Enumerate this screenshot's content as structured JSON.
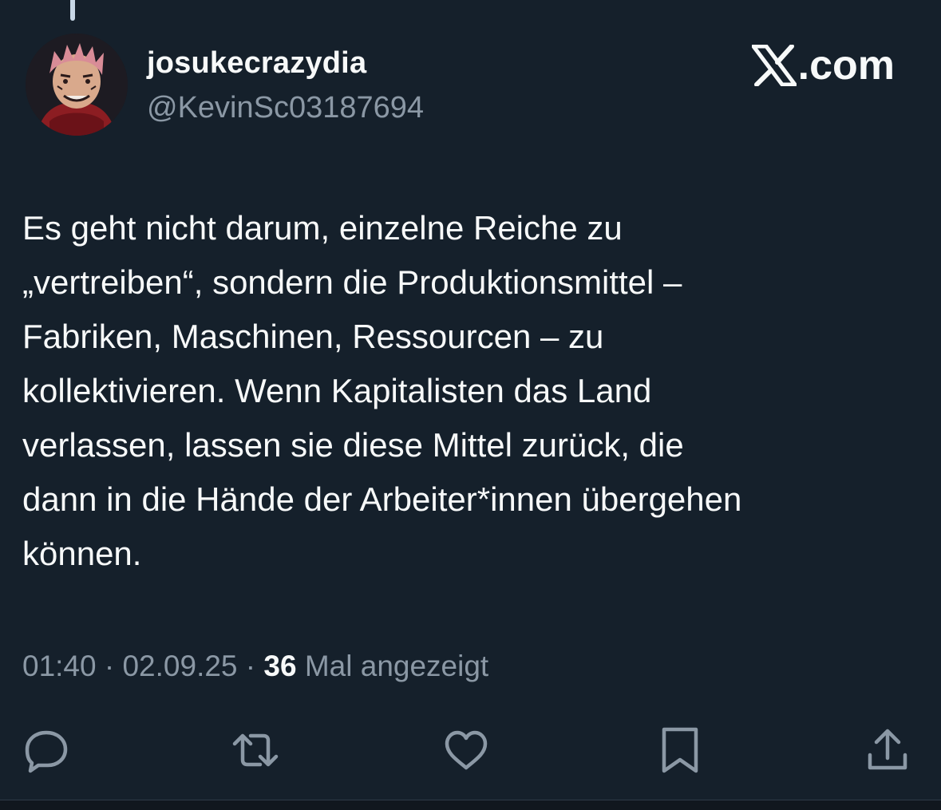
{
  "author": {
    "display_name": "josukecrazydia",
    "handle": "@KevinSc03187694",
    "avatar_icon": "avatar-anime-character"
  },
  "site": {
    "label": ".com",
    "logo_icon": "x-logo-icon"
  },
  "tweet": {
    "text": "Es geht nicht darum, einzelne Reiche zu\n„vertreiben“, sondern die Produktionsmittel –\nFabriken, Maschinen, Ressourcen – zu\nkollektivieren. Wenn Kapitalisten das Land\nverlassen, lassen sie diese Mittel zurück, die\ndann in die Hände der Arbeiter*innen übergehen\nkönnen."
  },
  "meta": {
    "time": "01:40",
    "separator": " · ",
    "date": "02.09.25",
    "views_count": "36",
    "views_label": " Mal angezeigt"
  },
  "actions": [
    {
      "name": "reply",
      "icon": "reply-icon"
    },
    {
      "name": "repost",
      "icon": "repost-icon"
    },
    {
      "name": "like",
      "icon": "heart-icon"
    },
    {
      "name": "bookmark",
      "icon": "bookmark-icon"
    },
    {
      "name": "share",
      "icon": "share-icon"
    }
  ],
  "colors": {
    "background": "#15202b",
    "text_primary": "#f7f9f9",
    "text_secondary": "#8b98a5"
  }
}
